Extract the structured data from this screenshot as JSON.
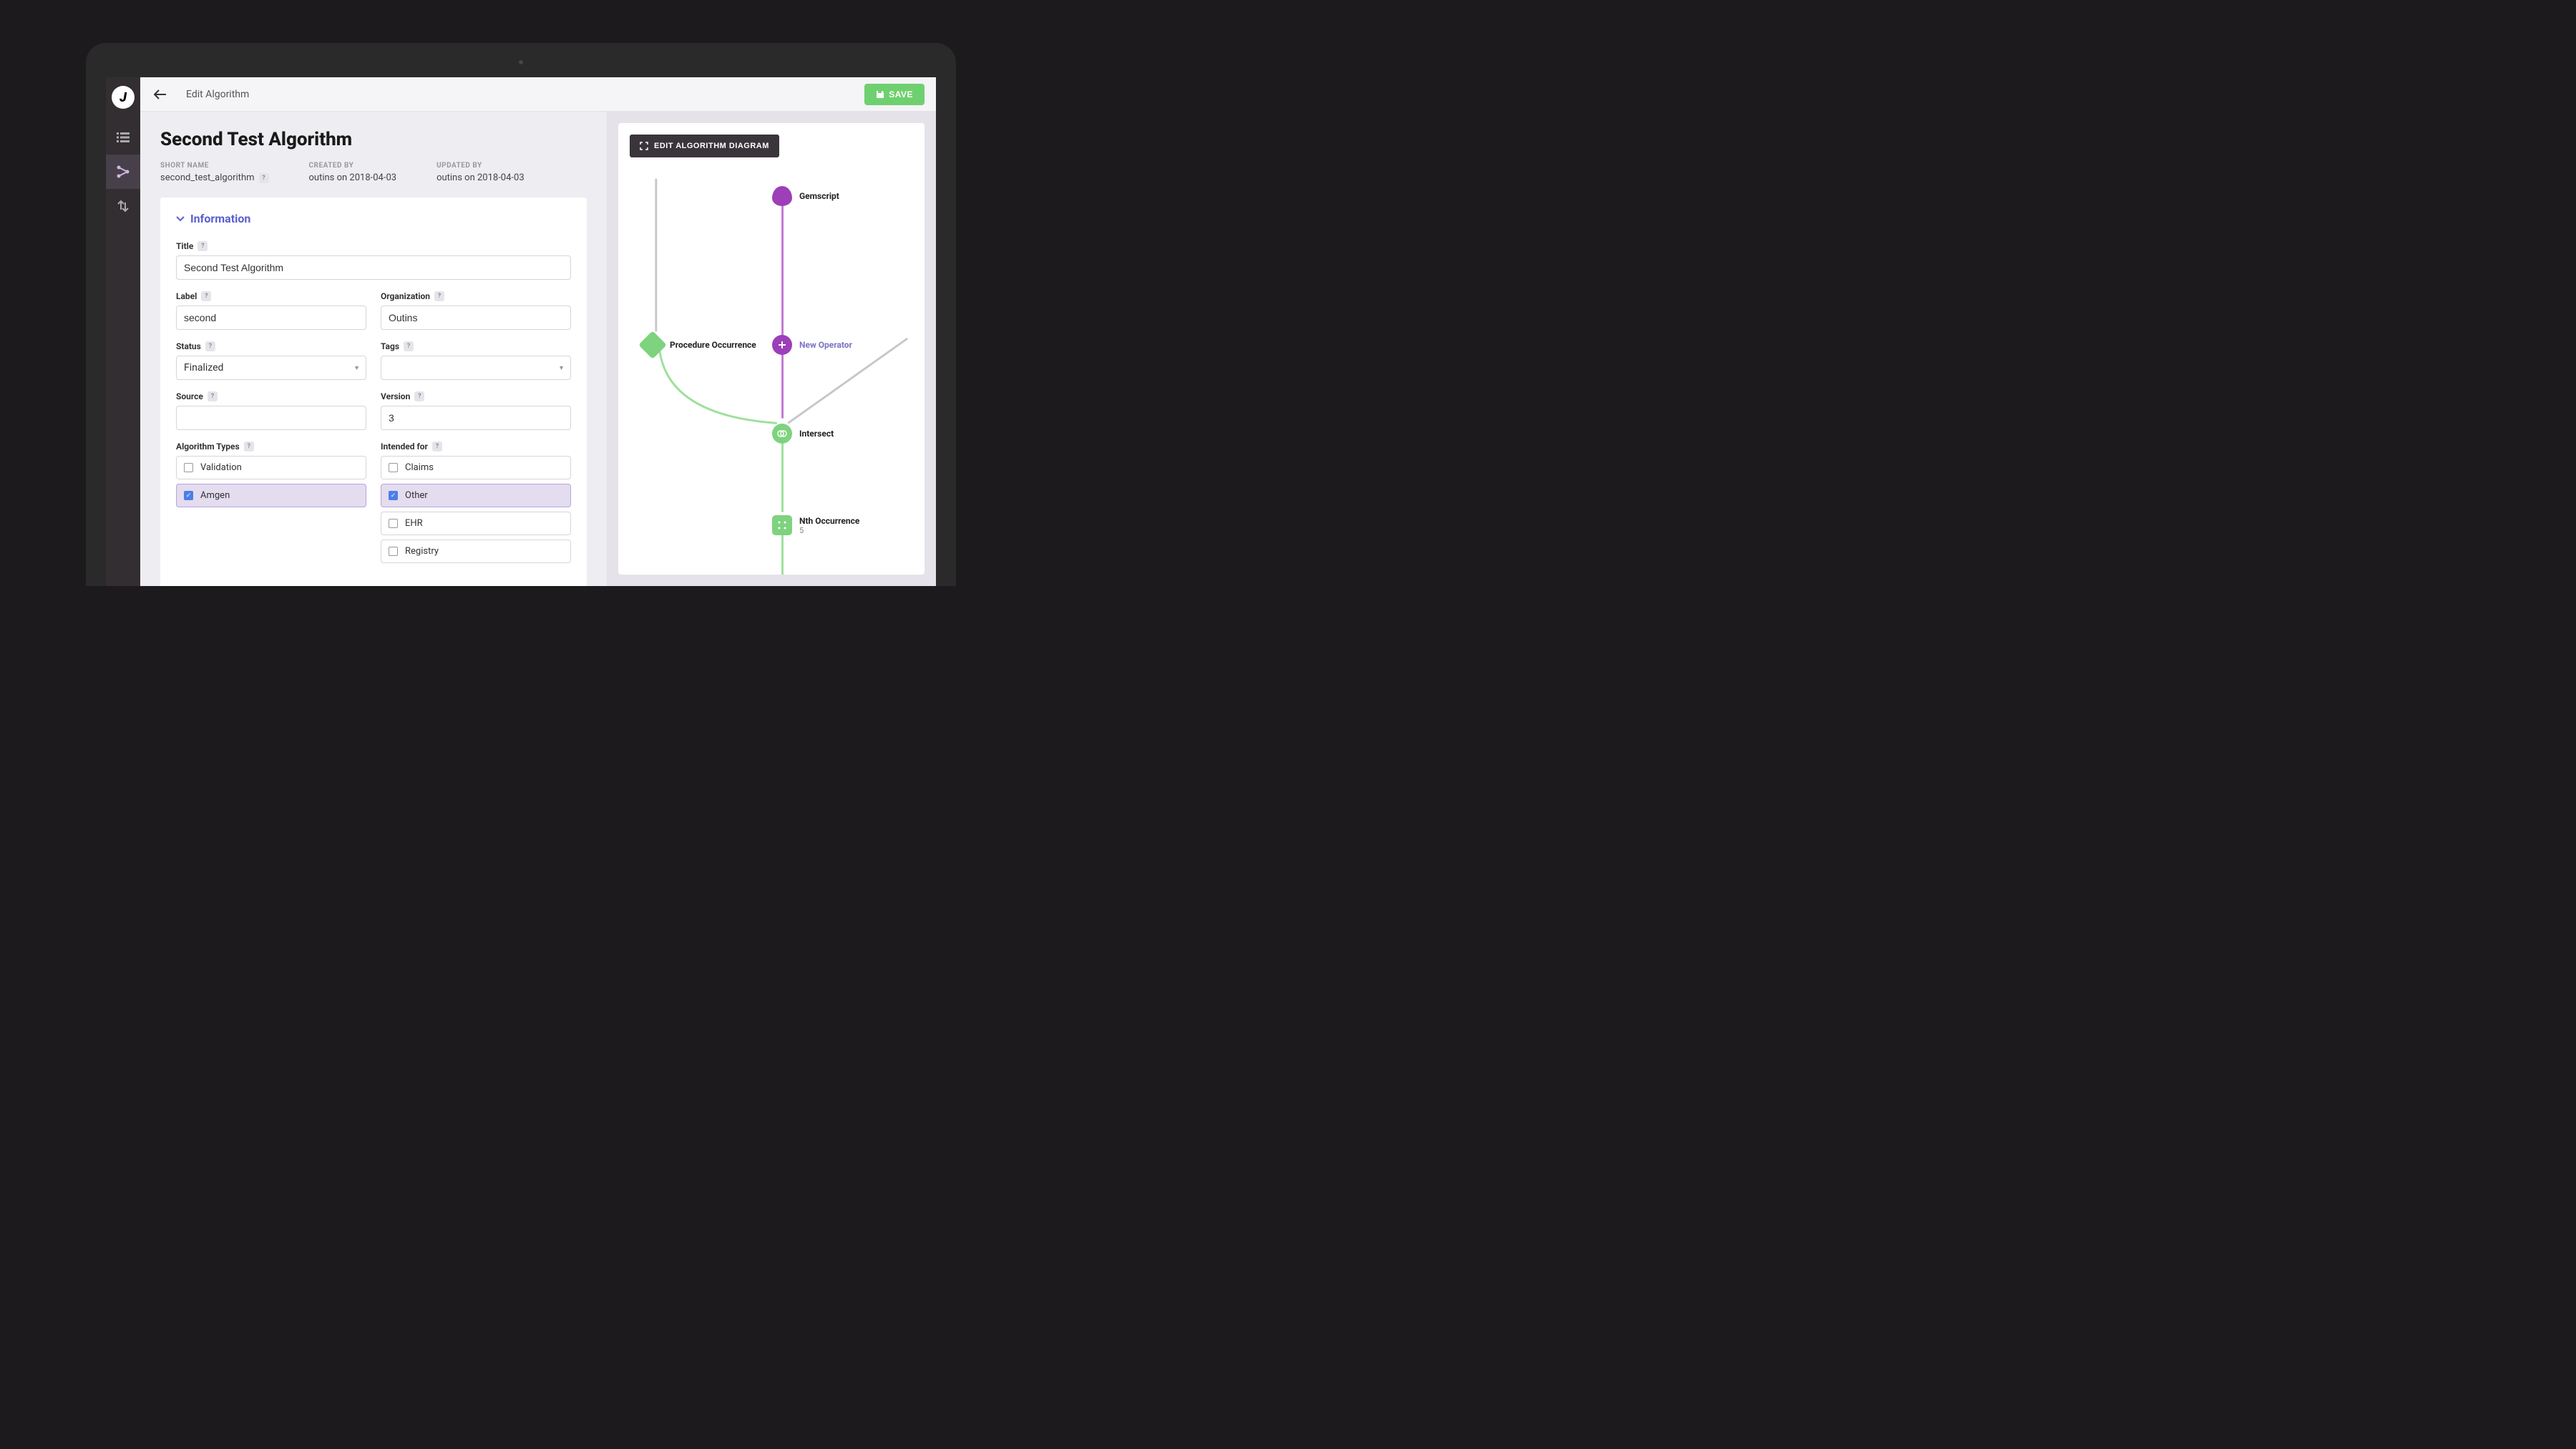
{
  "header": {
    "breadcrumb": "Edit Algorithm",
    "save_label": "SAVE"
  },
  "page": {
    "title": "Second Test Algorithm"
  },
  "meta": {
    "short_name_label": "SHORT NAME",
    "short_name": "second_test_algorithm",
    "created_by_label": "CREATED BY",
    "created_by": "outins on 2018-04-03",
    "updated_by_label": "UPDATED BY",
    "updated_by": "outins on 2018-04-03"
  },
  "section": {
    "information": "Information"
  },
  "form": {
    "title_label": "Title",
    "title_value": "Second Test Algorithm",
    "label_label": "Label",
    "label_value": "second",
    "organization_label": "Organization",
    "organization_value": "Outins",
    "status_label": "Status",
    "status_value": "Finalized",
    "tags_label": "Tags",
    "tags_value": "",
    "source_label": "Source",
    "source_value": "",
    "version_label": "Version",
    "version_value": "3",
    "algorithm_types_label": "Algorithm Types",
    "algorithm_types": [
      {
        "label": "Validation",
        "checked": false
      },
      {
        "label": "Amgen",
        "checked": true
      }
    ],
    "intended_for_label": "Intended for",
    "intended_for": [
      {
        "label": "Claims",
        "checked": false
      },
      {
        "label": "Other",
        "checked": true
      },
      {
        "label": "EHR",
        "checked": false
      },
      {
        "label": "Registry",
        "checked": false
      }
    ]
  },
  "diagram": {
    "edit_button": "EDIT ALGORITHM DIAGRAM",
    "nodes": {
      "gemscript": "Gemscript",
      "procedure": "Procedure Occurrence",
      "new_operator": "New Operator",
      "intersect": "Intersect",
      "nth": "Nth Occurrence",
      "nth_sub": "5"
    }
  }
}
